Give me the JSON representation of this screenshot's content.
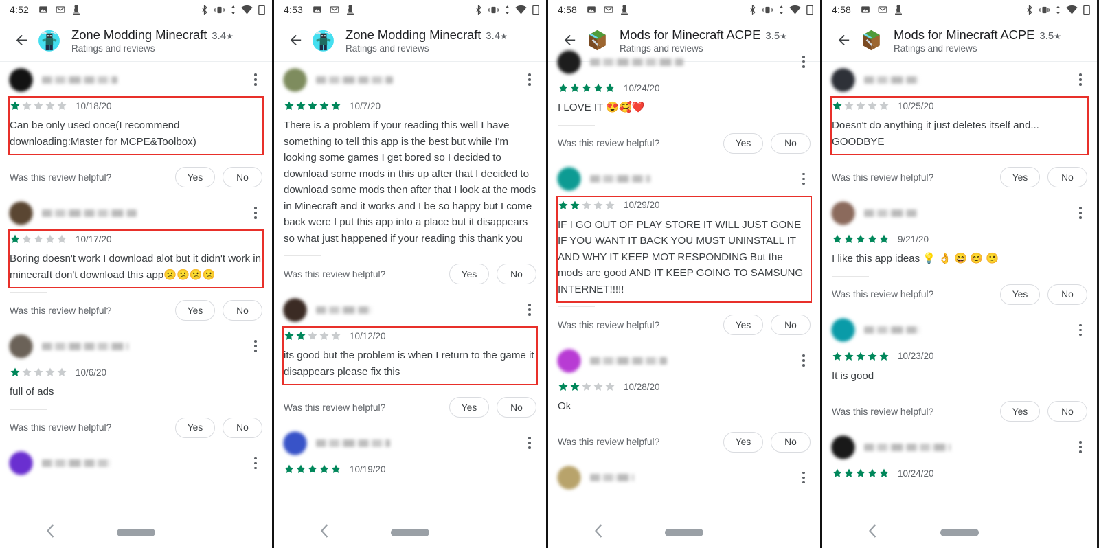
{
  "panels": [
    {
      "status": {
        "time": "4:52",
        "left_icons": [
          "photos-icon",
          "gmail-icon",
          "app-icon"
        ],
        "right_icons": [
          "bluetooth-icon",
          "vibrate-icon",
          "data-transfer-icon",
          "wifi-icon",
          "battery-icon"
        ]
      },
      "appbar": {
        "back": "back-arrow",
        "title": "Zone Modding Minecraft",
        "rating": "3.4",
        "subtitle": "Ratings and reviews",
        "icon": "zone-modding-minecraft-icon"
      },
      "reviews": [
        {
          "avatar_color": "#121212",
          "name_blurred": true,
          "name_width": 110,
          "stars": 1,
          "date": "10/18/20",
          "text": "Can be only used once(I recommend downloading:Master for MCPE&Toolbox)",
          "highlighted": true,
          "helpful": {
            "label": "Was this review helpful?",
            "yes": "Yes",
            "no": "No"
          }
        },
        {
          "avatar_color": "#5a4632",
          "name_blurred": true,
          "name_width": 138,
          "stars": 1,
          "date": "10/17/20",
          "text": "Boring doesn't work I download alot but it didn't work in minecraft don't download this app😕😕😕😕",
          "highlighted": true,
          "helpful": {
            "label": "Was this review helpful?",
            "yes": "Yes",
            "no": "No"
          }
        },
        {
          "avatar_color": "#6b6258",
          "name_blurred": true,
          "name_width": 126,
          "stars": 1,
          "date": "10/6/20",
          "text": "full of ads",
          "highlighted": false,
          "helpful": {
            "label": "Was this review helpful?",
            "yes": "Yes",
            "no": "No"
          }
        },
        {
          "avatar_color": "#6a2fd0",
          "name_blurred": true,
          "name_width": 100,
          "stars": null,
          "date": "",
          "text": "",
          "highlighted": false,
          "partial": true
        }
      ],
      "navbar": {
        "back": "nav-back-icon",
        "home": "nav-home-pill"
      }
    },
    {
      "status": {
        "time": "4:53",
        "left_icons": [
          "photos-icon",
          "gmail-icon",
          "app-icon"
        ],
        "right_icons": [
          "bluetooth-icon",
          "vibrate-icon",
          "data-transfer-icon",
          "wifi-icon",
          "battery-icon"
        ]
      },
      "appbar": {
        "back": "back-arrow",
        "title": "Zone Modding Minecraft",
        "rating": "3.4",
        "subtitle": "Ratings and reviews",
        "icon": "zone-modding-minecraft-icon"
      },
      "reviews": [
        {
          "avatar_color": "#7e8c5e",
          "name_blurred": true,
          "name_width": 112,
          "stars": 5,
          "date": "10/7/20",
          "text": "There is a problem if your reading this well I have something to tell this app is the best but while I'm looking some games I get bored so I decided to download some mods in this up after that I decided to download some mods then after that I look at the mods in Minecraft and it works and I be so happy but I come back were I put this app into a place but it disappears so what just happened if your reading this thank you",
          "highlighted": false,
          "helpful": {
            "label": "Was this review helpful?",
            "yes": "Yes",
            "no": "No"
          }
        },
        {
          "avatar_color": "#3b2b24",
          "name_blurred": true,
          "name_width": 82,
          "stars": 2,
          "date": "10/12/20",
          "text": "its good but the problem is when I return to the game it disappears please fix this",
          "highlighted": true,
          "helpful": {
            "label": "Was this review helpful?",
            "yes": "Yes",
            "no": "No"
          }
        },
        {
          "avatar_color": "#3853c8",
          "name_blurred": true,
          "name_width": 108,
          "stars": 5,
          "date": "10/19/20",
          "text": "",
          "highlighted": false,
          "partial": true
        }
      ],
      "navbar": {
        "back": "nav-back-icon",
        "home": "nav-home-pill"
      }
    },
    {
      "status": {
        "time": "4:58",
        "left_icons": [
          "photos-icon",
          "gmail-icon",
          "app-icon"
        ],
        "right_icons": [
          "bluetooth-icon",
          "vibrate-icon",
          "data-transfer-icon",
          "wifi-icon",
          "battery-icon"
        ]
      },
      "appbar": {
        "back": "back-arrow",
        "title": "Mods for Minecraft ACPE",
        "rating": "3.5",
        "subtitle": "Ratings and reviews",
        "icon": "mods-for-minecraft-acpe-icon"
      },
      "reviews": [
        {
          "avatar_color": "#1d1d1d",
          "name_blurred": true,
          "name_width": 136,
          "stars": 5,
          "date": "10/24/20",
          "text": "I LOVE IT 😍🥰❤️",
          "highlighted": false,
          "top_cut": true,
          "helpful": {
            "label": "Was this review helpful?",
            "yes": "Yes",
            "no": "No"
          }
        },
        {
          "avatar_color": "#0d9b93",
          "name_blurred": true,
          "name_width": 88,
          "stars": 2,
          "date": "10/29/20",
          "text": "IF I GO OUT OF PLAY STORE IT WILL JUST GONE IF YOU WANT IT BACK YOU MUST UNINSTALL IT AND WHY IT KEEP MOT RESPONDING But the mods are good AND IT KEEP GOING TO SAMSUNG INTERNET!!!!!",
          "highlighted": true,
          "helpful": {
            "label": "Was this review helpful?",
            "yes": "Yes",
            "no": "No"
          }
        },
        {
          "avatar_color": "#b83bd4",
          "name_blurred": true,
          "name_width": 112,
          "stars": 2,
          "date": "10/28/20",
          "text": "Ok",
          "highlighted": false,
          "helpful": {
            "label": "Was this review helpful?",
            "yes": "Yes",
            "no": "No"
          }
        },
        {
          "avatar_color": "#b8a36b",
          "name_blurred": true,
          "name_width": 64,
          "stars": null,
          "date": "",
          "text": "",
          "highlighted": false,
          "partial": true
        }
      ],
      "navbar": {
        "back": "nav-back-icon",
        "home": "nav-home-pill"
      }
    },
    {
      "status": {
        "time": "4:58",
        "left_icons": [
          "photos-icon",
          "gmail-icon",
          "app-icon"
        ],
        "right_icons": [
          "bluetooth-icon",
          "vibrate-icon",
          "data-transfer-icon",
          "wifi-icon",
          "battery-icon"
        ]
      },
      "appbar": {
        "back": "back-arrow",
        "title": "Mods for Minecraft ACPE",
        "rating": "3.5",
        "subtitle": "Ratings and reviews",
        "icon": "mods-for-minecraft-acpe-icon"
      },
      "reviews": [
        {
          "avatar_color": "#2e3138",
          "name_blurred": true,
          "name_width": 80,
          "stars": 1,
          "date": "10/25/20",
          "text": "Doesn't do anything it just deletes itself and...\nGOODBYE",
          "highlighted": true,
          "helpful": {
            "label": "Was this review helpful?",
            "yes": "Yes",
            "no": "No"
          }
        },
        {
          "avatar_color": "#8b6a5c",
          "name_blurred": true,
          "name_width": 78,
          "stars": 5,
          "date": "9/21/20",
          "text": "I like this app ideas 💡 👌 😄 😊 🙂",
          "highlighted": false,
          "helpful": {
            "label": "Was this review helpful?",
            "yes": "Yes",
            "no": "No"
          }
        },
        {
          "avatar_color": "#0a9ba8",
          "name_blurred": true,
          "name_width": 82,
          "stars": 5,
          "date": "10/23/20",
          "text": "It is good",
          "highlighted": false,
          "helpful": {
            "label": "Was this review helpful?",
            "yes": "Yes",
            "no": "No"
          }
        },
        {
          "avatar_color": "#191919",
          "name_blurred": true,
          "name_width": 126,
          "stars": 5,
          "date": "10/24/20",
          "text": "",
          "highlighted": false,
          "partial": true
        }
      ],
      "navbar": {
        "back": "nav-back-icon",
        "home": "nav-home-pill"
      }
    }
  ],
  "colors": {
    "star_filled": "#00875a",
    "star_empty": "#c9ccce",
    "highlight": "#e8302a",
    "text_primary": "#3c4043",
    "text_secondary": "#5f6368"
  }
}
